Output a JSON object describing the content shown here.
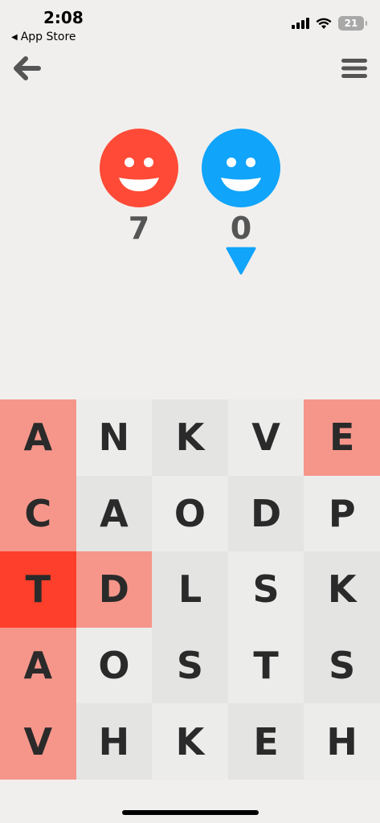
{
  "status_bar": {
    "time": "2:08",
    "back_app": "App Store",
    "battery": "21"
  },
  "players": [
    {
      "name": "red-player",
      "color": "#fe4a36",
      "score": "7"
    },
    {
      "name": "blue-player",
      "color": "#10a4fb",
      "score": "0"
    }
  ],
  "current_turn": "blue",
  "board": [
    [
      {
        "l": "A",
        "s": "red-light"
      },
      {
        "l": "N",
        "s": "light"
      },
      {
        "l": "K",
        "s": "dark"
      },
      {
        "l": "V",
        "s": "light"
      },
      {
        "l": "E",
        "s": "red-light"
      }
    ],
    [
      {
        "l": "C",
        "s": "red-light"
      },
      {
        "l": "A",
        "s": "dark"
      },
      {
        "l": "O",
        "s": "light"
      },
      {
        "l": "D",
        "s": "dark"
      },
      {
        "l": "P",
        "s": "light"
      }
    ],
    [
      {
        "l": "T",
        "s": "red-dark"
      },
      {
        "l": "D",
        "s": "red-light"
      },
      {
        "l": "L",
        "s": "dark"
      },
      {
        "l": "S",
        "s": "light"
      },
      {
        "l": "K",
        "s": "dark"
      }
    ],
    [
      {
        "l": "A",
        "s": "red-light"
      },
      {
        "l": "O",
        "s": "light"
      },
      {
        "l": "S",
        "s": "dark"
      },
      {
        "l": "T",
        "s": "light"
      },
      {
        "l": "S",
        "s": "dark"
      }
    ],
    [
      {
        "l": "V",
        "s": "red-light"
      },
      {
        "l": "H",
        "s": "dark"
      },
      {
        "l": "K",
        "s": "light"
      },
      {
        "l": "E",
        "s": "dark"
      },
      {
        "l": "H",
        "s": "light"
      }
    ]
  ],
  "icons": {
    "back": "arrow-left-icon",
    "menu": "hamburger-menu-icon",
    "turn": "triangle-down-icon"
  }
}
